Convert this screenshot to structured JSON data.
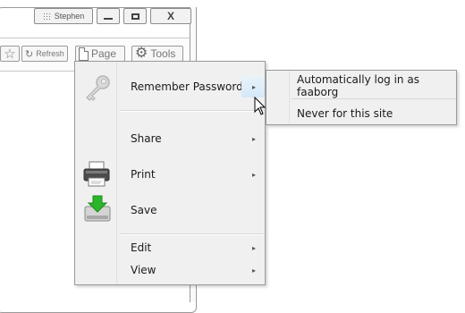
{
  "window": {
    "user_name": "Stephen",
    "close_label": "X",
    "toolbar": {
      "star_icon": "star-icon",
      "refresh_label": "Refresh",
      "page_label": "Page",
      "tools_label": "Tools"
    }
  },
  "context_menu": {
    "items": [
      {
        "label": "Remember Password",
        "icon": "key-icon",
        "has_submenu": true,
        "highlighted": true
      },
      {
        "label": "Share",
        "has_submenu": true
      },
      {
        "label": "Print",
        "icon": "printer-icon",
        "has_submenu": true
      },
      {
        "label": "Save",
        "icon": "save-disk-icon",
        "has_submenu": false
      },
      {
        "label": "Edit",
        "has_submenu": true
      },
      {
        "label": "View",
        "has_submenu": true
      }
    ],
    "arrow_glyph": "▸"
  },
  "submenu": {
    "items": [
      {
        "label": "Automatically log in as faaborg"
      },
      {
        "label": "Never for this site"
      }
    ]
  },
  "colors": {
    "menu_bg": "#f0f0f0",
    "highlight": "#d5e8f7",
    "border": "#9a9a9a",
    "save_arrow": "#2bb52b"
  }
}
